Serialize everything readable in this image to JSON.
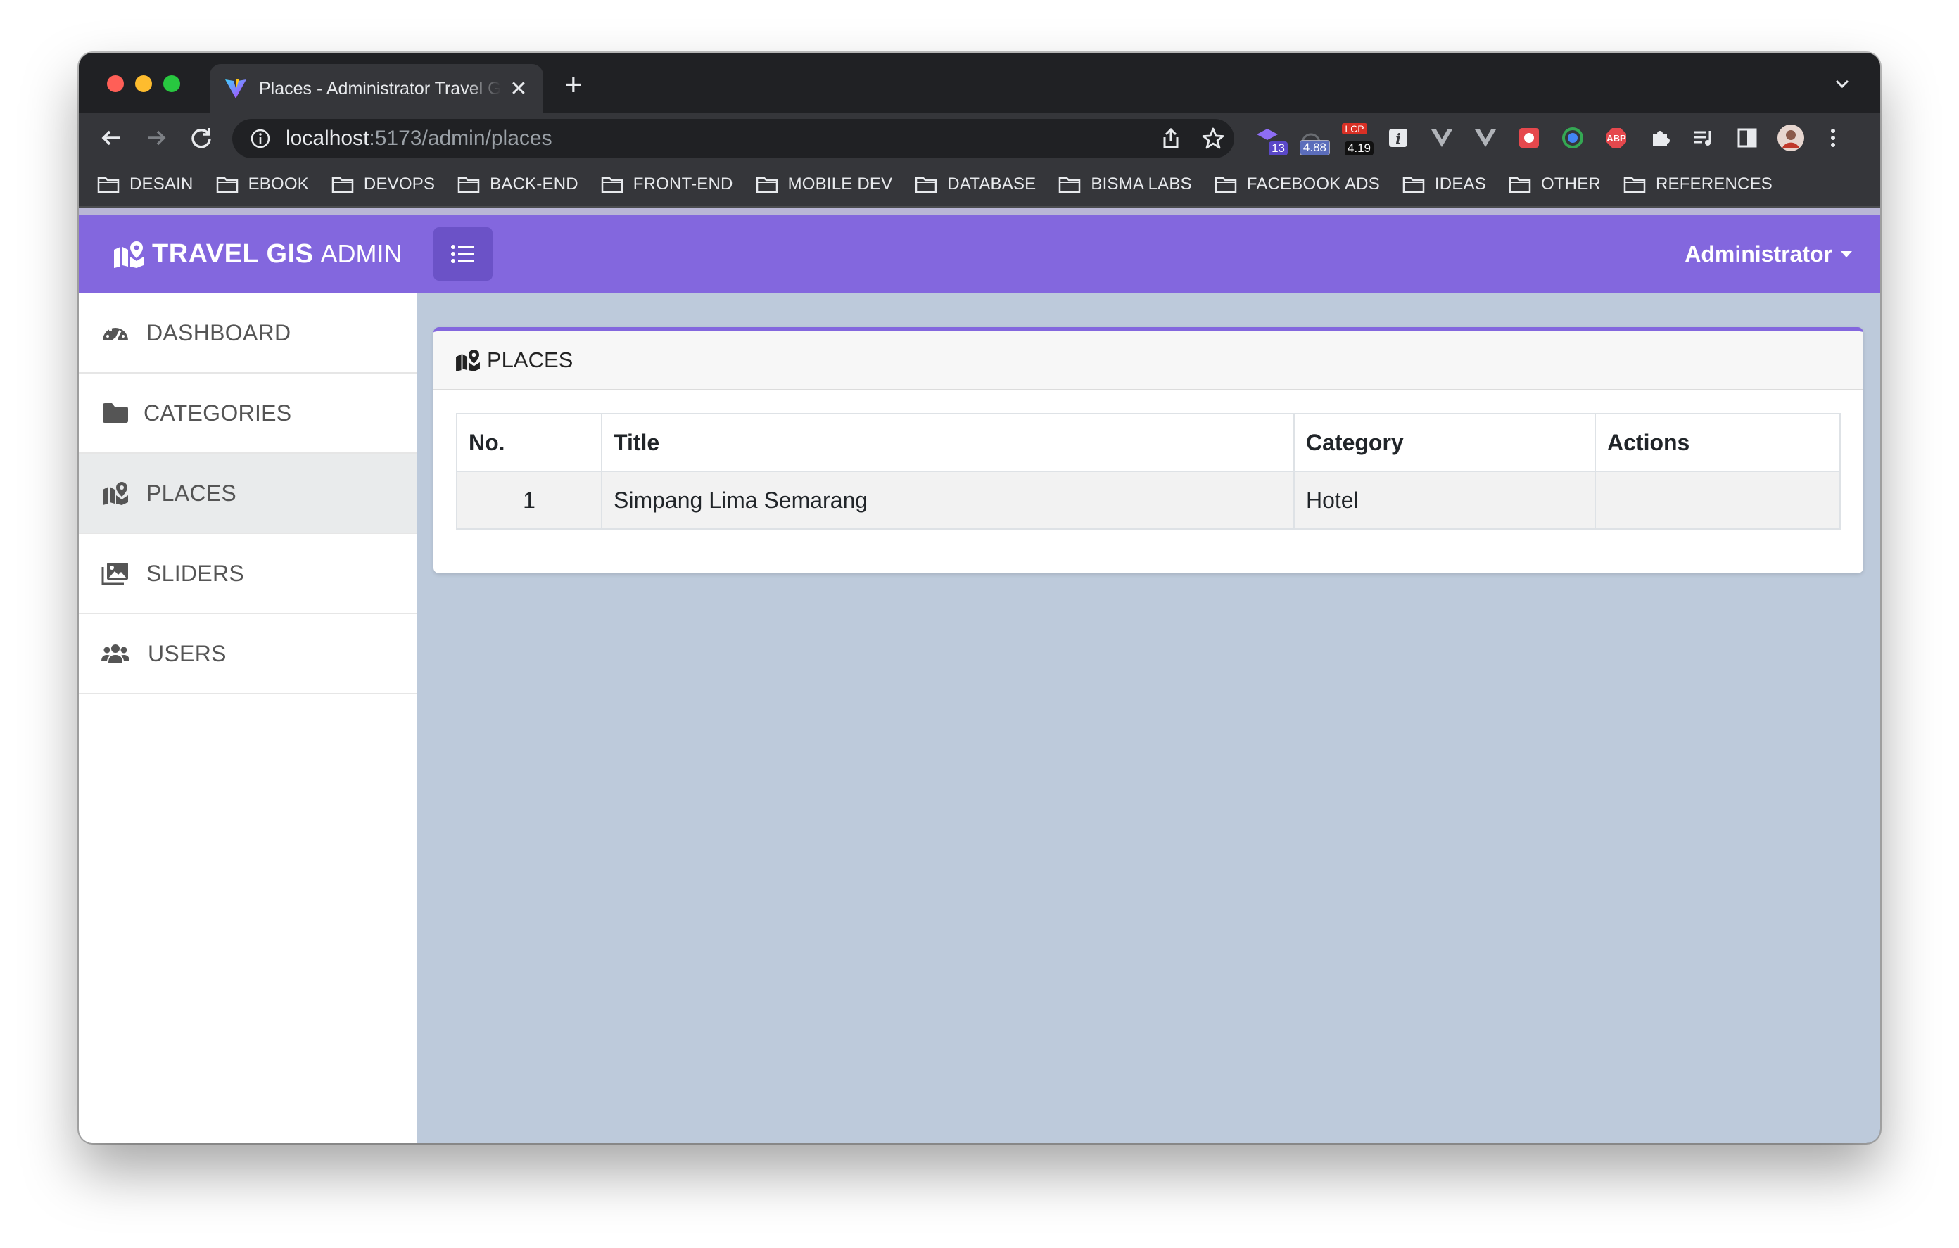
{
  "browser": {
    "tab_title": "Places - Administrator Travel GIS",
    "url_host": "localhost",
    "url_path": ":5173/admin/places",
    "extensions": [
      {
        "name": "wappalyzer-icon",
        "badge": "13"
      },
      {
        "name": "speed-icon",
        "badge": "4.88"
      },
      {
        "name": "lcp-icon",
        "badge": "4.19",
        "label": "LCP"
      },
      {
        "name": "info-icon"
      },
      {
        "name": "vue-devtools-icon"
      },
      {
        "name": "vue-devtools-icon-2"
      },
      {
        "name": "red-ext-icon"
      },
      {
        "name": "colorzilla-icon"
      },
      {
        "name": "adblock-icon",
        "label": "ABP"
      },
      {
        "name": "puzzle-icon"
      },
      {
        "name": "media-icon"
      },
      {
        "name": "sidepanel-icon"
      },
      {
        "name": "avatar"
      },
      {
        "name": "kebab-menu-icon"
      }
    ],
    "bookmarks": [
      "DESAIN",
      "EBOOK",
      "DEVOPS",
      "BACK-END",
      "FRONT-END",
      "MOBILE DEV",
      "DATABASE",
      "BISMA LABS",
      "FACEBOOK ADS",
      "IDEAS",
      "OTHER",
      "REFERENCES"
    ]
  },
  "app": {
    "brand_bold": "TRAVEL GIS",
    "brand_light": "ADMIN",
    "user_menu": "Administrator",
    "accent_color": "#8367de",
    "sidebar": [
      {
        "label": "DASHBOARD",
        "icon": "dashboard-icon",
        "active": false
      },
      {
        "label": "CATEGORIES",
        "icon": "folder-icon",
        "active": false
      },
      {
        "label": "PLACES",
        "icon": "map-marker-icon",
        "active": true
      },
      {
        "label": "SLIDERS",
        "icon": "images-icon",
        "active": false
      },
      {
        "label": "USERS",
        "icon": "users-icon",
        "active": false
      }
    ],
    "card": {
      "title": "PLACES",
      "columns": [
        "No.",
        "Title",
        "Category",
        "Actions"
      ],
      "rows": [
        [
          "1",
          "Simpang Lima Semarang",
          "Hotel",
          ""
        ]
      ]
    }
  }
}
